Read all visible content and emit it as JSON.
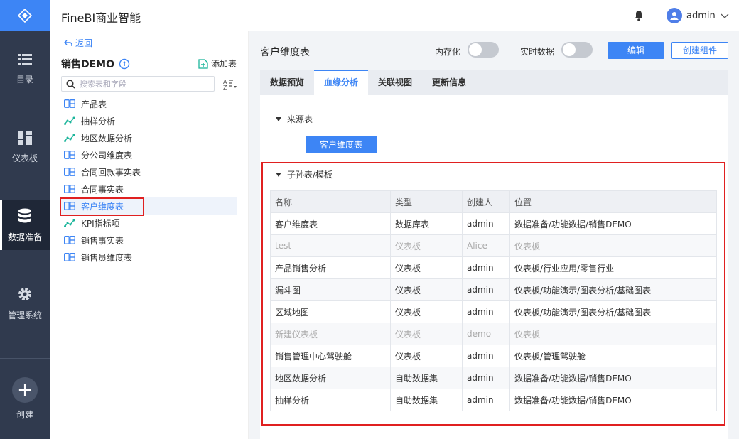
{
  "app": {
    "title": "FineBI商业智能",
    "user": "admin"
  },
  "nav": {
    "items": [
      {
        "label": "目录",
        "icon": "list-icon"
      },
      {
        "label": "仪表板",
        "icon": "dashboard-icon"
      },
      {
        "label": "数据准备",
        "icon": "database-icon"
      },
      {
        "label": "管理系统",
        "icon": "gear-icon"
      }
    ],
    "create_label": "创建"
  },
  "left": {
    "back": "返回",
    "package": "销售DEMO",
    "add_table": "添加表",
    "search_placeholder": "搜索表和字段",
    "tables": [
      {
        "name": "产品表",
        "type": "db"
      },
      {
        "name": "抽样分析",
        "type": "analysis"
      },
      {
        "name": "地区数据分析",
        "type": "analysis"
      },
      {
        "name": "分公司维度表",
        "type": "db"
      },
      {
        "name": "合同回款事实表",
        "type": "db"
      },
      {
        "name": "合同事实表",
        "type": "db"
      },
      {
        "name": "客户维度表",
        "type": "db",
        "selected": true
      },
      {
        "name": "KPI指标项",
        "type": "analysis"
      },
      {
        "name": "销售事实表",
        "type": "db"
      },
      {
        "name": "销售员维度表",
        "type": "db"
      }
    ]
  },
  "main": {
    "title": "客户维度表",
    "memory_label": "内存化",
    "realtime_label": "实时数据",
    "edit_label": "编辑",
    "create_component_label": "创建组件",
    "tabs": [
      "数据预览",
      "血缘分析",
      "关联视图",
      "更新信息"
    ],
    "active_tab": 1,
    "source_section": "来源表",
    "source_table": "客户维度表",
    "child_section": "子孙表/模板",
    "table": {
      "headers": [
        "名称",
        "类型",
        "创建人",
        "位置"
      ],
      "rows": [
        [
          "客户维度表",
          "数据库表",
          "admin",
          "数据准备/功能数据/销售DEMO"
        ],
        [
          "test",
          "仪表板",
          "Alice",
          "仪表板"
        ],
        [
          "产品销售分析",
          "仪表板",
          "admin",
          "仪表板/行业应用/零售行业"
        ],
        [
          "漏斗图",
          "仪表板",
          "admin",
          "仪表板/功能演示/图表分析/基础图表"
        ],
        [
          "区域地图",
          "仪表板",
          "admin",
          "仪表板/功能演示/图表分析/基础图表"
        ],
        [
          "新建仪表板",
          "仪表板",
          "demo",
          "仪表板"
        ],
        [
          "销售管理中心驾驶舱",
          "仪表板",
          "admin",
          "仪表板/管理驾驶舱"
        ],
        [
          "地区数据分析",
          "自助数据集",
          "admin",
          "数据准备/功能数据/销售DEMO"
        ],
        [
          "抽样分析",
          "自助数据集",
          "admin",
          "数据准备/功能数据/销售DEMO"
        ]
      ],
      "dim_rows": [
        1,
        5
      ]
    }
  },
  "colors": {
    "accent": "#3d85f5",
    "nav_bg": "#303a4e",
    "highlight": "#e02020"
  }
}
